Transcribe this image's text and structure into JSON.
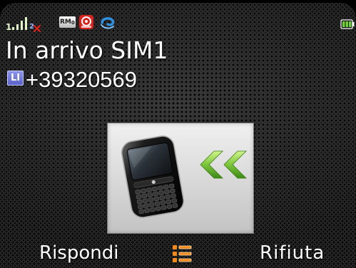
{
  "status_bar": {
    "signal_sim1": "1",
    "signal_sim2": "2",
    "rm_label": "RM",
    "rm_sub": "0",
    "icons": [
      "signal-icon",
      "no-data-icon",
      "rm-icon",
      "notification-icon",
      "wave-icon",
      "battery-icon"
    ]
  },
  "call": {
    "title": "In arrivo SIM1",
    "line_badge": "LI",
    "number": "+39320569"
  },
  "caller_image": {
    "icons": [
      "phone-icon",
      "incoming-arrows-icon"
    ]
  },
  "softkeys": {
    "left": "Rispondi",
    "center_icon": "menu-list-icon",
    "right": "Rifiuta"
  },
  "colors": {
    "text": "#ffffff",
    "menu": "#f08a1c",
    "badge": "#5a62c8",
    "nodata": "#e0241b",
    "battery": "#6fd23a",
    "arrows": "#7cc53a"
  }
}
